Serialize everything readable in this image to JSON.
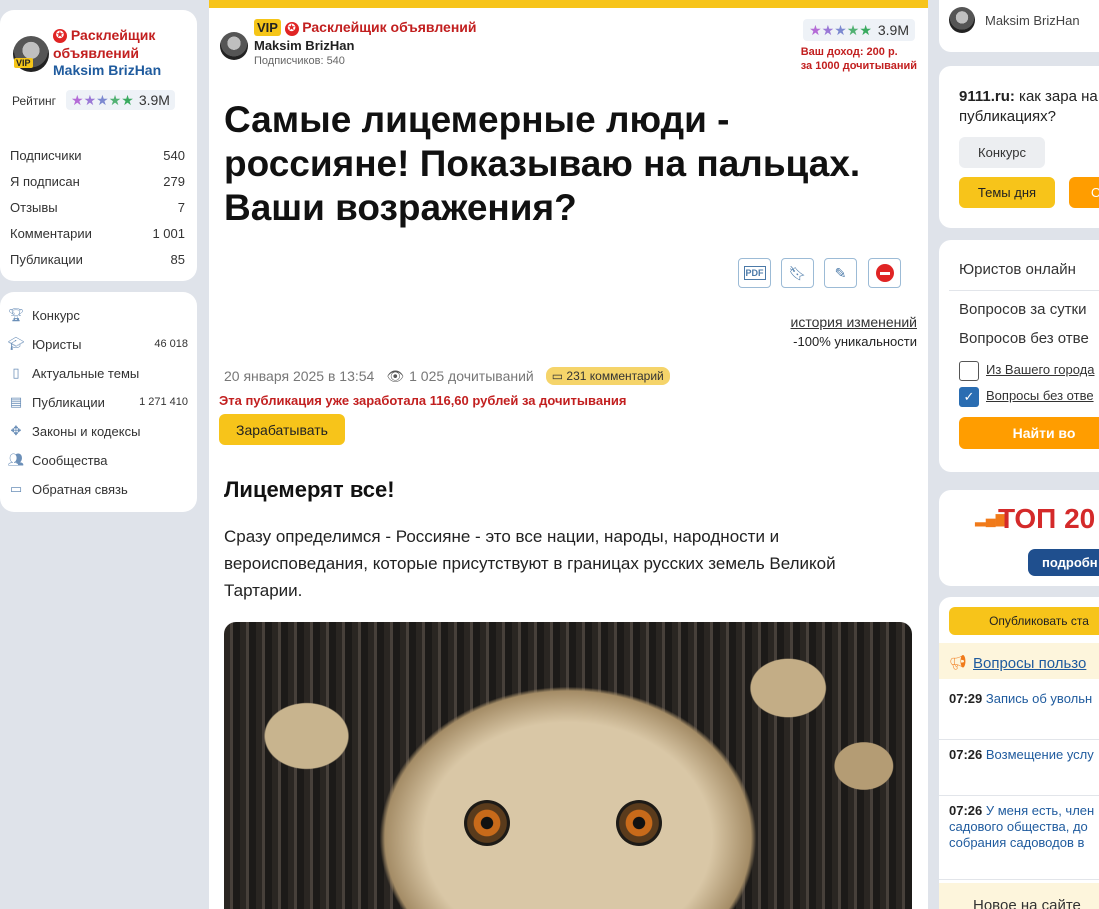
{
  "profile": {
    "role": "Расклейщик объявлений",
    "name": "Maksim BrizHan",
    "vip_label": "VIP",
    "rating_label": "Рейтинг",
    "rating_value": "3.9M",
    "stats": [
      {
        "label": "Подписчики",
        "value": "540"
      },
      {
        "label": "Я подписан",
        "value": "279"
      },
      {
        "label": "Отзывы",
        "value": "7"
      },
      {
        "label": "Комментарии",
        "value": "1 001"
      },
      {
        "label": "Публикации",
        "value": "85"
      }
    ]
  },
  "nav": [
    {
      "label": "Конкурс",
      "count": "",
      "icon": "trophy-icon"
    },
    {
      "label": "Юристы",
      "count": "46 018",
      "icon": "graduation-cap-icon"
    },
    {
      "label": "Актуальные темы",
      "count": "",
      "icon": "document-icon"
    },
    {
      "label": "Публикации",
      "count": "1 271 410",
      "icon": "newspaper-icon"
    },
    {
      "label": "Законы и кодексы",
      "count": "",
      "icon": "emblem-icon"
    },
    {
      "label": "Сообщества",
      "count": "",
      "icon": "people-icon"
    },
    {
      "label": "Обратная связь",
      "count": "",
      "icon": "chat-icon"
    }
  ],
  "article": {
    "vip_label": "VIP",
    "author_role": "Расклейщик объявлений",
    "author_name": "Maksim BrizHan",
    "subscribers": "Подписчиков: 540",
    "rating": "3.9M",
    "income_line1": "Ваш доход: 200 р.",
    "income_line2": "за 1000 дочитываний",
    "title": "Самые лицемерные люди - россияне! Показываю на пальцах. Ваши возражения?",
    "history_link": "история изменений",
    "uniqueness": "-100% уникальности",
    "date": "20 января 2025 в 13:54",
    "reads": "1 025 дочитываний",
    "comments": "231 комментарий",
    "earned": "Эта публикация уже заработала 116,60 рублей за дочитывания",
    "earn_button": "Зарабатывать",
    "subtitle": "Лицемерят все!",
    "paragraph": "Сразу определимся - Россияне - это все нации, народы, народности и вероисповедания, которые присутствуют в границах русских земель Великой Тартарии."
  },
  "right": {
    "user_name": "Maksim BrizHan",
    "promo_site": "9111.ru:",
    "promo_text": " как зара на публикациях?",
    "contest_button": "Конкурс",
    "topics_button": "Темы дня",
    "orange_button": "От",
    "lawyers_title": "Юристов онлайн",
    "questions_day": "Вопросов за сутки",
    "questions_unanswered": "Вопросов без отве",
    "check_city": "Из Вашего города",
    "check_unanswered": "Вопросы без отве",
    "find_button": "Найти во",
    "top_label": "ТОП 20",
    "details_button": "подробн",
    "publish_button": "Опубликовать ста",
    "user_questions": "Вопросы пользо",
    "feed": [
      {
        "time": "07:29",
        "text": "Запись об увольн"
      },
      {
        "time": "07:26",
        "text": "Возмещение услу"
      },
      {
        "time": "07:26",
        "text": "У меня есть, член садового общества, до собрания садоводов в"
      }
    ],
    "new_on_site": "Новое на сайте"
  }
}
